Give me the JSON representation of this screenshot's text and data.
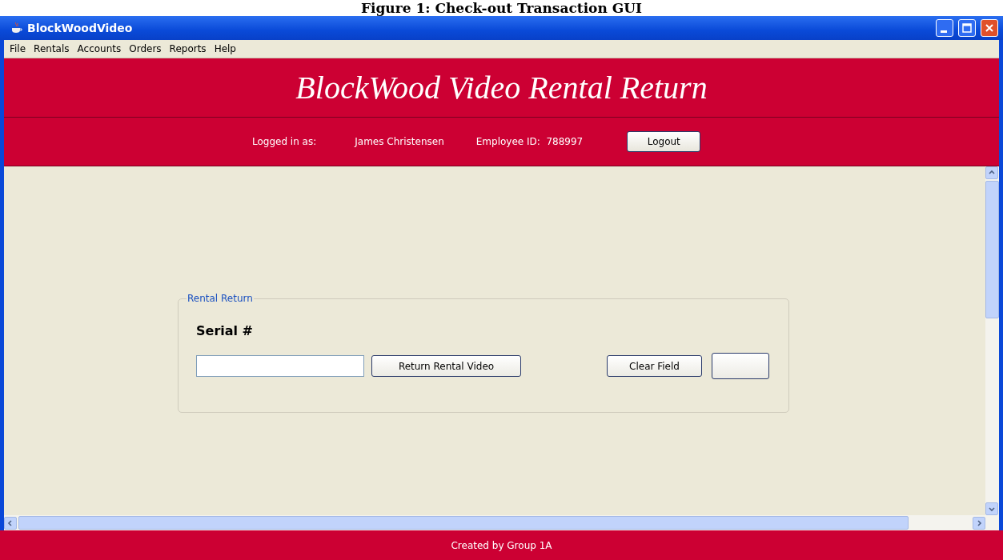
{
  "caption": "Figure 1: Check-out Transaction GUI",
  "window": {
    "title": "BlockWoodVideo"
  },
  "menu": [
    "File",
    "Rentals",
    "Accounts",
    "Orders",
    "Reports",
    "Help"
  ],
  "banner": {
    "title": "BlockWood Video Rental Return"
  },
  "session": {
    "logged_in_label": "Logged in as:",
    "user": "James Christensen",
    "employee_id": "Employee ID:  788997",
    "logout": "Logout"
  },
  "panel": {
    "legend": "Rental Return",
    "serial_label": "Serial #",
    "return_button": "Return Rental Video",
    "clear_button": "Clear Field"
  },
  "footer": "Created by Group 1A"
}
